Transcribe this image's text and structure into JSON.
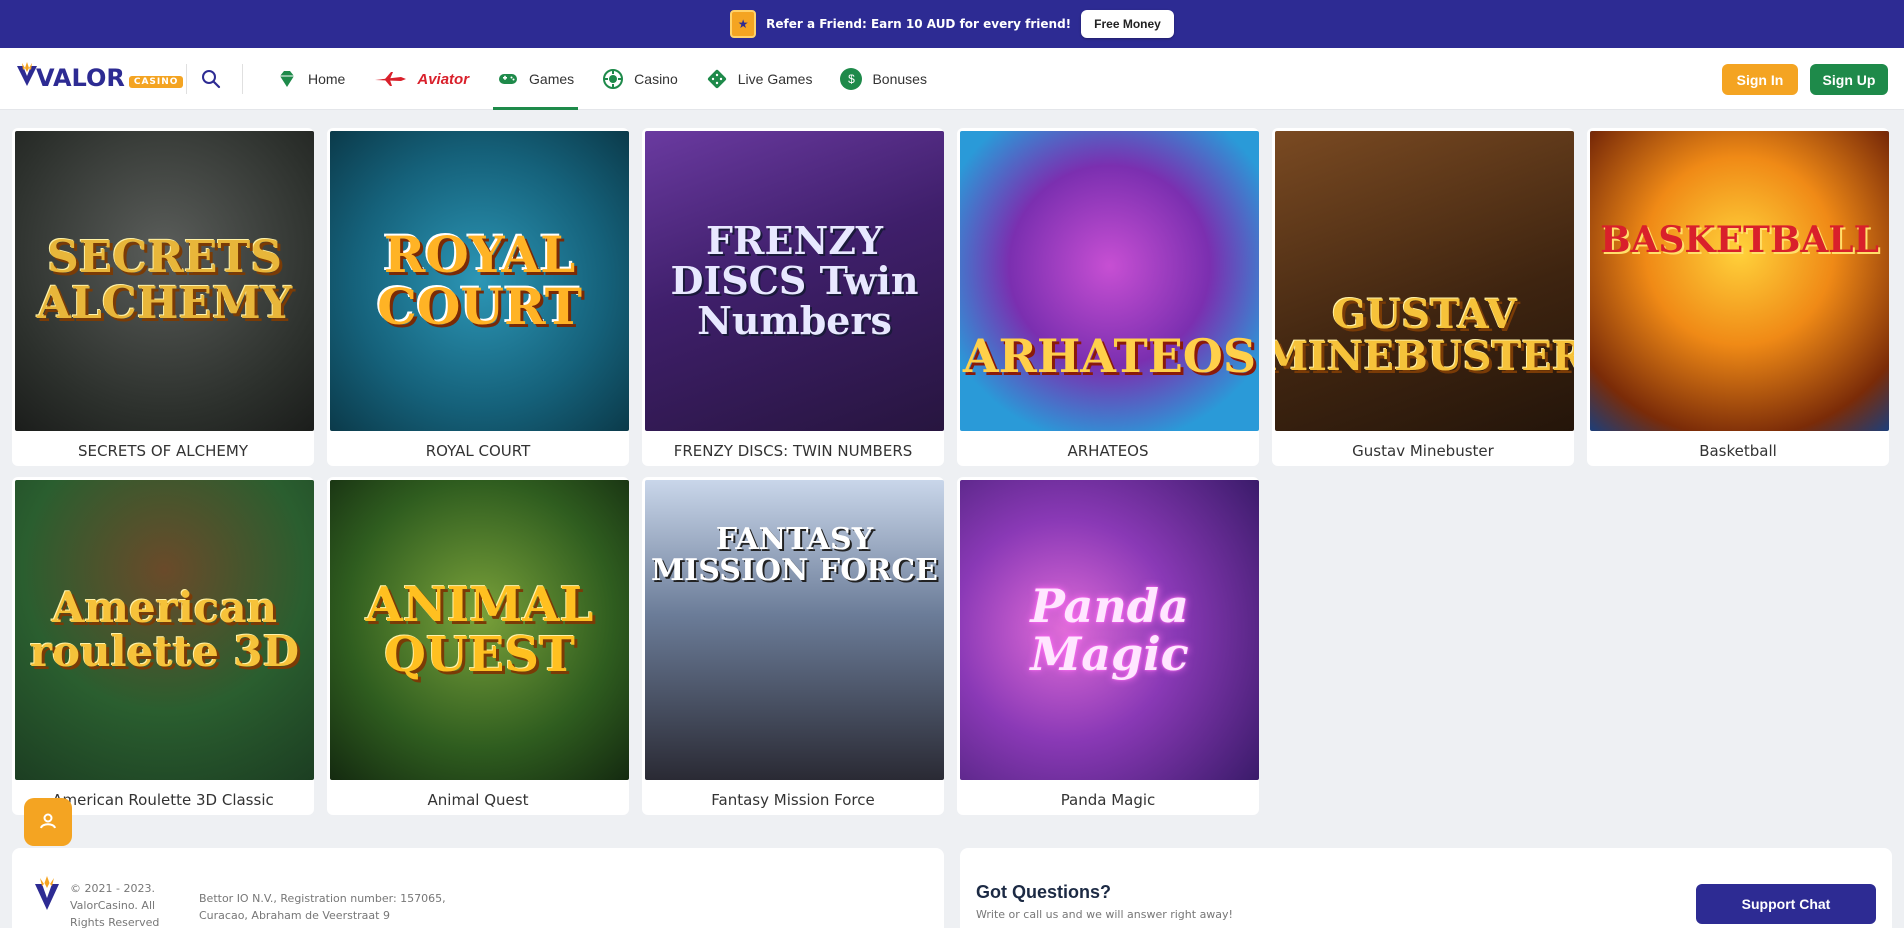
{
  "promo": {
    "text": "Refer a Friend: Earn 10 AUD for every friend!",
    "button": "Free Money"
  },
  "header": {
    "logo_word": "VALOR",
    "logo_badge": "CASINO",
    "search_icon": "search-icon",
    "nav": [
      {
        "label": "Home",
        "icon": "diamond-icon",
        "active": false
      },
      {
        "label": "Aviator",
        "icon": "plane-icon",
        "active": false
      },
      {
        "label": "Games",
        "icon": "gamepad-icon",
        "active": true
      },
      {
        "label": "Casino",
        "icon": "chip-icon",
        "active": false
      },
      {
        "label": "Live Games",
        "icon": "dice-icon",
        "active": false
      },
      {
        "label": "Bonuses",
        "icon": "dollar-icon",
        "active": false
      }
    ],
    "sign_in": "Sign In",
    "sign_up": "Sign Up"
  },
  "games": [
    {
      "title": "SECRETS OF ALCHEMY",
      "art": "SECRETS ALCHEMY"
    },
    {
      "title": "ROYAL COURT",
      "art": "ROYAL COURT"
    },
    {
      "title": "FRENZY DISCS: TWIN NUMBERS",
      "art": "FRENZY DISCS Twin Numbers"
    },
    {
      "title": "ARHATEOS",
      "art": "ARHATEOS"
    },
    {
      "title": "Gustav Minebuster",
      "art": "GUSTAV MINEBUSTER"
    },
    {
      "title": "Basketball",
      "art": "BASKETBALL"
    },
    {
      "title": "American Roulette 3D Classic",
      "art": "American roulette 3D"
    },
    {
      "title": "Animal Quest",
      "art": "ANIMAL QUEST"
    },
    {
      "title": "Fantasy Mission Force",
      "art": "FANTASY MISSION FORCE"
    },
    {
      "title": "Panda Magic",
      "art": "Panda Magic"
    }
  ],
  "footer": {
    "copyright": "© 2021 - 2023. ValorCasino. All Rights Reserved",
    "registration": "Bettor IO N.V., Registration number: 157065, Curacao, Abraham de Veerstraat 9",
    "questions_title": "Got Questions?",
    "questions_sub": "Write or call us and we will answer right away!",
    "support_button": "Support Chat"
  },
  "colors": {
    "brand_purple": "#2d2b93",
    "accent_orange": "#f4a422",
    "accent_green": "#1e8a4a"
  }
}
